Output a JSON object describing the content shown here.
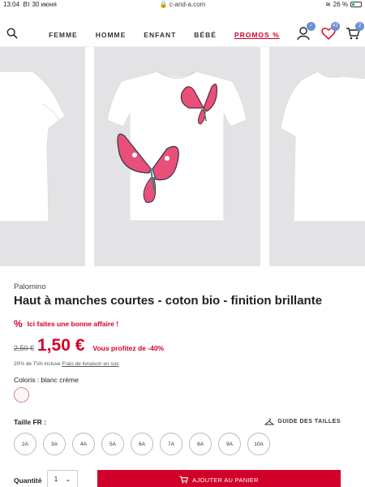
{
  "status": {
    "time": "13:04",
    "date": "Вт 30 июня",
    "url": "c-and-a.com",
    "battery": "26 %"
  },
  "nav": {
    "menu": [
      "FEMME",
      "HOMME",
      "ENFANT",
      "BÉBÉ",
      "PROMOS %"
    ],
    "wishlist_count": "41",
    "cart_count": "2"
  },
  "product": {
    "brand": "Palomino",
    "title": "Haut à manches courtes - coton bio - finition brillante",
    "deal_text": "Ici faites une bonne affaire !",
    "old_price": "2,50 €",
    "new_price": "1,50 €",
    "savings": "Vous profitez de -40%",
    "vat_text": "20% de TVA incluse",
    "shipping_link": "Frais de livraison en sus",
    "color_label": "Coloris : blanc crème",
    "swatch_color": "#fbf7f4"
  },
  "sizing": {
    "label": "Taille FR :",
    "guide": "GUIDE DES TAILLES",
    "sizes": [
      "2A",
      "3A",
      "4A",
      "5A",
      "6A",
      "7A",
      "8A",
      "9A",
      "10A"
    ]
  },
  "purchase": {
    "qty_label": "Quantité",
    "qty_value": "1",
    "add_to_cart": "AJOUTER AU PANIER"
  },
  "colors": {
    "accent": "#d4002a",
    "tile_bg": "#e3e3e5",
    "butterfly_pink": "#e8507a",
    "badge": "#6b8fd8"
  }
}
